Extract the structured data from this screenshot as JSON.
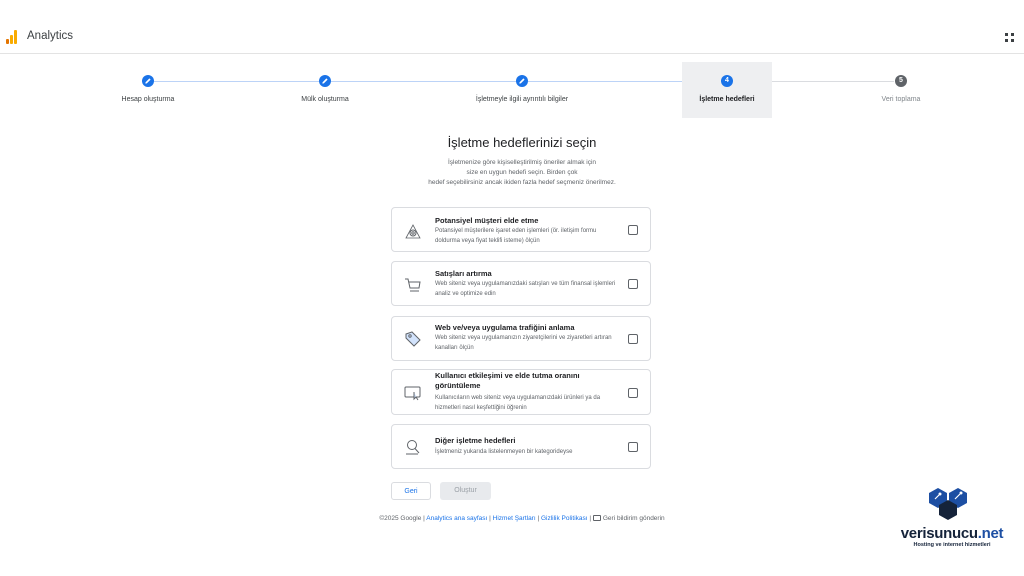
{
  "header": {
    "app_title": "Analytics",
    "icons": {
      "logo": "analytics-logo",
      "apps": "apps-grid-icon"
    }
  },
  "stepper": {
    "steps": [
      {
        "label": "Hesap oluşturma",
        "state": "done",
        "marker_icon": "pencil-icon"
      },
      {
        "label": "Mülk oluşturma",
        "state": "done",
        "marker_icon": "pencil-icon"
      },
      {
        "label": "İşletmeyle ilgili ayrıntılı bilgiler",
        "state": "done",
        "marker_icon": "pencil-icon"
      },
      {
        "label": "İşletme hedefleri",
        "state": "active",
        "number": "4"
      },
      {
        "label": "Veri toplama",
        "state": "pending",
        "number": "5"
      }
    ]
  },
  "main": {
    "title": "İşletme hedeflerinizi seçin",
    "intro_lines": [
      "İşletmenize göre kişiselleştirilmiş öneriler almak için",
      "size en uygun hedefi seçin. Birden çok",
      "hedef seçebilirsiniz ancak ikiden fazla hedef seçmeniz önerilmez."
    ],
    "options": [
      {
        "title": "Potansiyel müşteri elde etme",
        "desc": "Potansiyel müşterilere işaret eden işlemleri (ör. iletişim formu doldurma veya fiyat teklifi isteme) ölçün",
        "icon": "target-person-icon",
        "checked": false
      },
      {
        "title": "Satışları artırma",
        "desc": "Web siteniz veya uygulamanızdaki satışları ve tüm finansal işlemleri analiz ve optimize edin",
        "icon": "shopping-cart-icon",
        "checked": false
      },
      {
        "title": "Web ve/veya uygulama trafiğini anlama",
        "desc": "Web siteniz veya uygulamanızın ziyaretçilerini ve ziyaretleri artıran kanalları ölçün",
        "icon": "tag-icon",
        "checked": false
      },
      {
        "title": "Kullanıcı etkileşimi ve elde tutma oranını görüntüleme",
        "desc": "Kullanıcıların web siteniz veya uygulamanızdaki ürünleri ya da hizmetleri nasıl keşfettiğini öğrenin",
        "icon": "screen-cursor-icon",
        "checked": false
      },
      {
        "title": "Diğer işletme hedefleri",
        "desc": "İşletmeniz yukarıda listelenmeyen bir kategorideyse",
        "icon": "search-document-icon",
        "checked": false
      }
    ],
    "back_label": "Geri",
    "create_label": "Oluştur"
  },
  "footer": {
    "copyright": "©2025 Google | ",
    "links": [
      "Analytics ana sayfası",
      "Hizmet Şartları",
      "Gizlilik Politikası"
    ],
    "separator": " | ",
    "feedback": "Geri bildirim gönderin",
    "feedback_icon": "feedback-icon"
  },
  "watermark": {
    "name_main": "verisunucu",
    "name_accent": ".net",
    "tagline": "Hosting ve internet hizmetleri",
    "colors": {
      "dark": "#15233a",
      "accent": "#1d4fa3"
    }
  },
  "colors": {
    "primary": "#1a73e8",
    "active_step_bg": "#eeeff1"
  }
}
